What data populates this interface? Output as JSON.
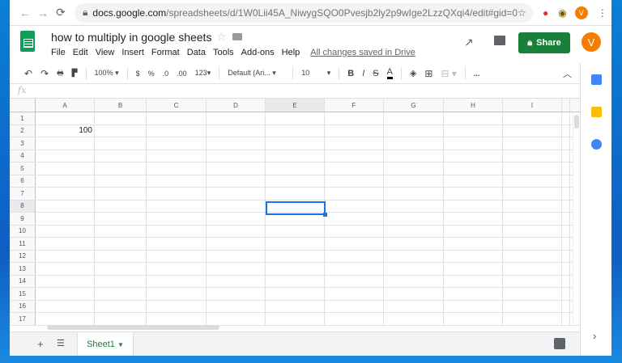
{
  "browser": {
    "url_host": "docs.google.com",
    "url_path": "/spreadsheets/d/1W0Lii45A_NiwygSQO0Pvesjb2ly2p9wIge2LzzQXqi4/edit#gid=0",
    "profile_initial": "V"
  },
  "doc": {
    "title": "how to multiply in google sheets",
    "save_status": "All changes saved in Drive",
    "share_label": "Share",
    "avatar_initial": "V"
  },
  "menu": [
    "File",
    "Edit",
    "View",
    "Insert",
    "Format",
    "Data",
    "Tools",
    "Add-ons",
    "Help"
  ],
  "toolbar": {
    "zoom": "100%",
    "currency": "$",
    "percent": "%",
    "dec_less": ".0",
    "dec_more": ".00",
    "format_more": "123",
    "font": "Default (Ari...",
    "font_size": "10",
    "more": "..."
  },
  "formula_bar": {
    "fx": "fx",
    "value": ""
  },
  "grid": {
    "columns": [
      "A",
      "B",
      "C",
      "D",
      "E",
      "F",
      "G",
      "H",
      "I"
    ],
    "rows": [
      "1",
      "2",
      "3",
      "4",
      "5",
      "6",
      "7",
      "8",
      "9",
      "10",
      "11",
      "12",
      "13",
      "14",
      "15",
      "16",
      "17"
    ],
    "cells": {
      "A2": "100"
    },
    "selected": "E8"
  },
  "sheets": [
    {
      "name": "Sheet1",
      "active": true
    }
  ],
  "colors": {
    "share": "#188038",
    "selection": "#1a73e8",
    "avatar": "#f57c00"
  }
}
